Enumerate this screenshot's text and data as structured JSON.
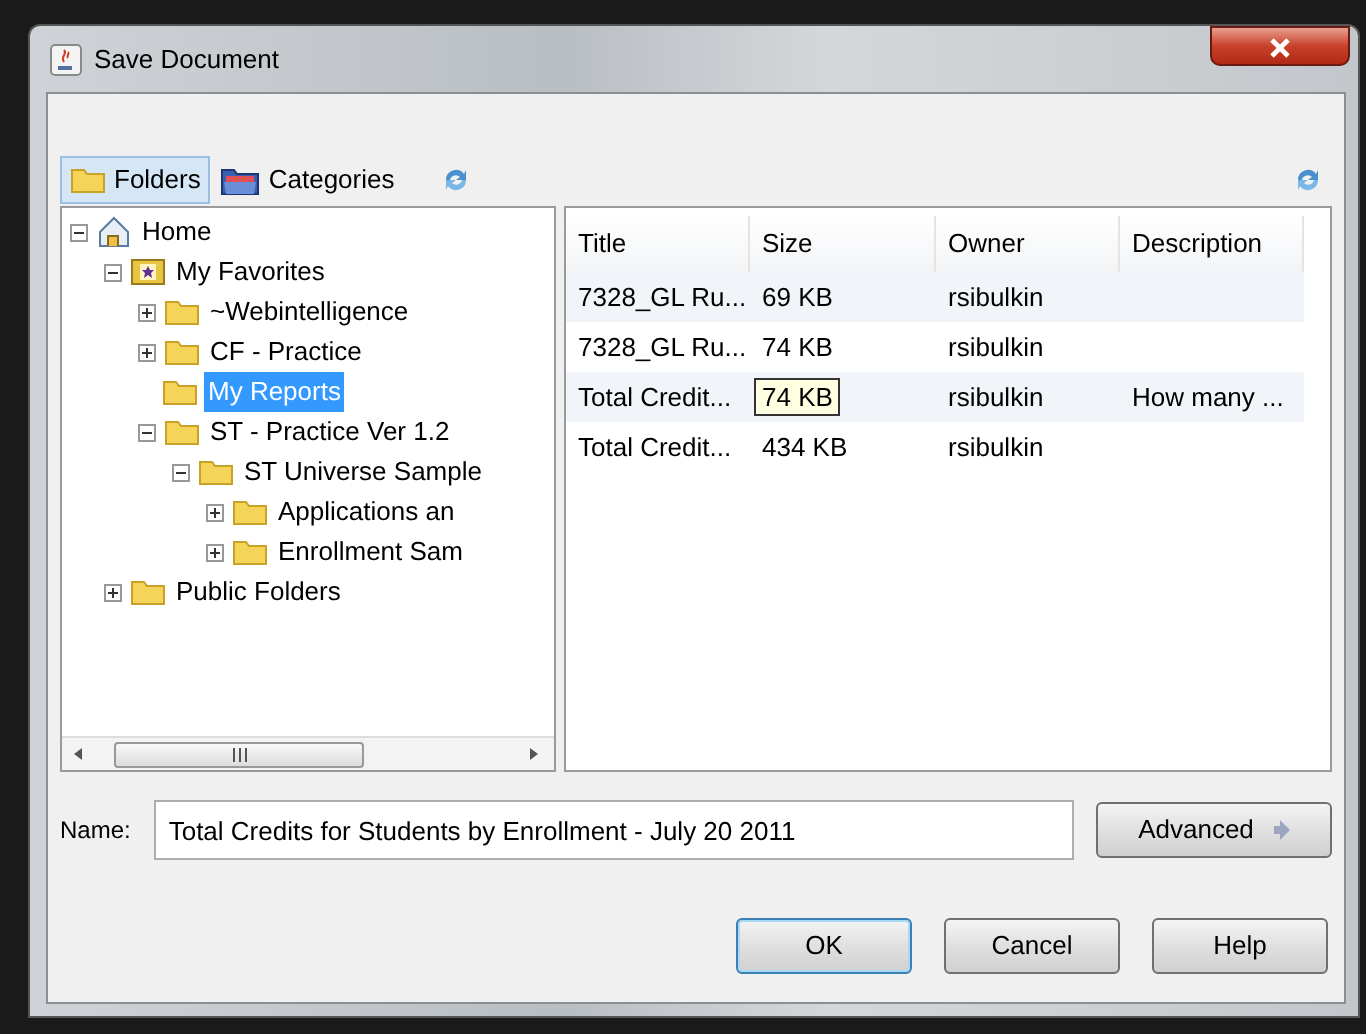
{
  "window": {
    "title": "Save Document"
  },
  "tabs": [
    {
      "label": "Folders",
      "kind": "folder",
      "selected": true
    },
    {
      "label": "Categories",
      "kind": "categories",
      "selected": false
    }
  ],
  "tree": [
    {
      "label": "Home",
      "kind": "home",
      "expanded": true,
      "selected": false,
      "children": [
        {
          "label": "My Favorites",
          "kind": "favorites",
          "expanded": true,
          "selected": false,
          "children": [
            {
              "label": "~Webintelligence",
              "kind": "folder",
              "expanded": false,
              "selected": false
            },
            {
              "label": "CF - Practice",
              "kind": "folder",
              "expanded": false,
              "selected": false
            },
            {
              "label": "My Reports",
              "kind": "folder",
              "selected": true
            },
            {
              "label": "ST - Practice Ver 1.2",
              "kind": "folder",
              "expanded": true,
              "selected": false,
              "children": [
                {
                  "label": "ST Universe Sample",
                  "kind": "folder",
                  "expanded": true,
                  "selected": false,
                  "children": [
                    {
                      "label": "Applications an",
                      "kind": "folder",
                      "expanded": false,
                      "selected": false
                    },
                    {
                      "label": "Enrollment Sam",
                      "kind": "folder",
                      "expanded": false,
                      "selected": false
                    }
                  ]
                }
              ]
            }
          ]
        },
        {
          "label": "Public Folders",
          "kind": "folder",
          "expanded": false,
          "selected": false
        }
      ]
    }
  ],
  "table": {
    "columns": [
      "Title",
      "Size",
      "Owner",
      "Description"
    ],
    "rows": [
      [
        "7328_GL Ru...",
        "69 KB",
        "rsibulkin",
        ""
      ],
      [
        "7328_GL Ru...",
        "74 KB",
        "rsibulkin",
        ""
      ],
      [
        "Total Credit...",
        {
          "tooltip": "74 KB"
        },
        "rsibulkin",
        "How many ..."
      ],
      [
        "Total Credit...",
        "434 KB",
        "rsibulkin",
        ""
      ]
    ]
  },
  "name_field": {
    "label": "Name:",
    "value": "Total Credits for Students by Enrollment - July 20 2011"
  },
  "advanced_button": "Advanced",
  "buttons": [
    {
      "label": "OK",
      "default": true
    },
    {
      "label": "Cancel",
      "default": false
    },
    {
      "label": "Help",
      "default": false
    }
  ]
}
